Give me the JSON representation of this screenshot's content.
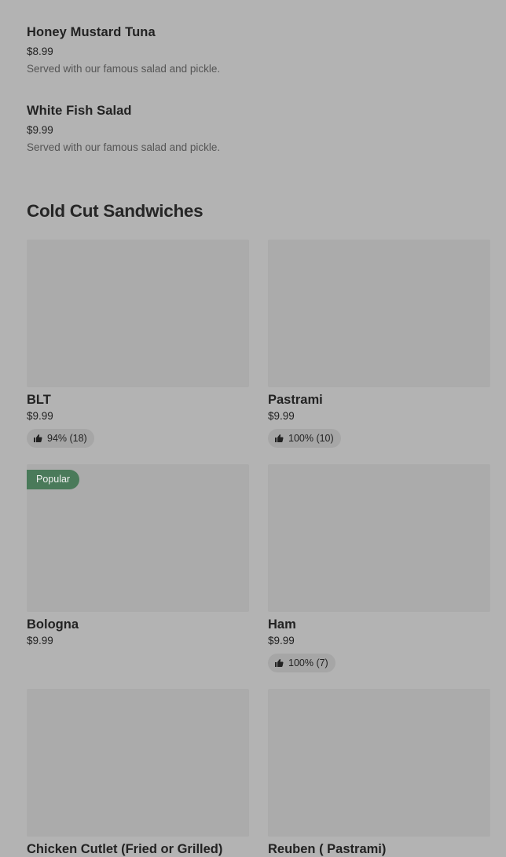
{
  "menu_items": [
    {
      "name": "Honey Mustard Tuna",
      "price": "$8.99",
      "description": "Served with our famous salad and pickle."
    },
    {
      "name": "White Fish Salad",
      "price": "$9.99",
      "description": "Served with our famous salad and pickle."
    }
  ],
  "section": {
    "title": "Cold Cut Sandwiches"
  },
  "cards": [
    {
      "name": "BLT",
      "price": "$9.99",
      "rating": "94% (18)"
    },
    {
      "name": "Pastrami",
      "price": "$9.99",
      "rating": "100% (10)"
    },
    {
      "name": "Bologna",
      "price": "$9.99",
      "badge": "Popular"
    },
    {
      "name": "Ham",
      "price": "$9.99",
      "rating": "100% (7)"
    },
    {
      "name": "Chicken Cutlet (Fried or Grilled)"
    },
    {
      "name": "Reuben ( Pastrami)"
    }
  ],
  "icons": {
    "rating": "thumbs-up-icon"
  },
  "colors": {
    "overlay_background": "#b3b3b3",
    "badge_background": "#4a7a5a"
  }
}
